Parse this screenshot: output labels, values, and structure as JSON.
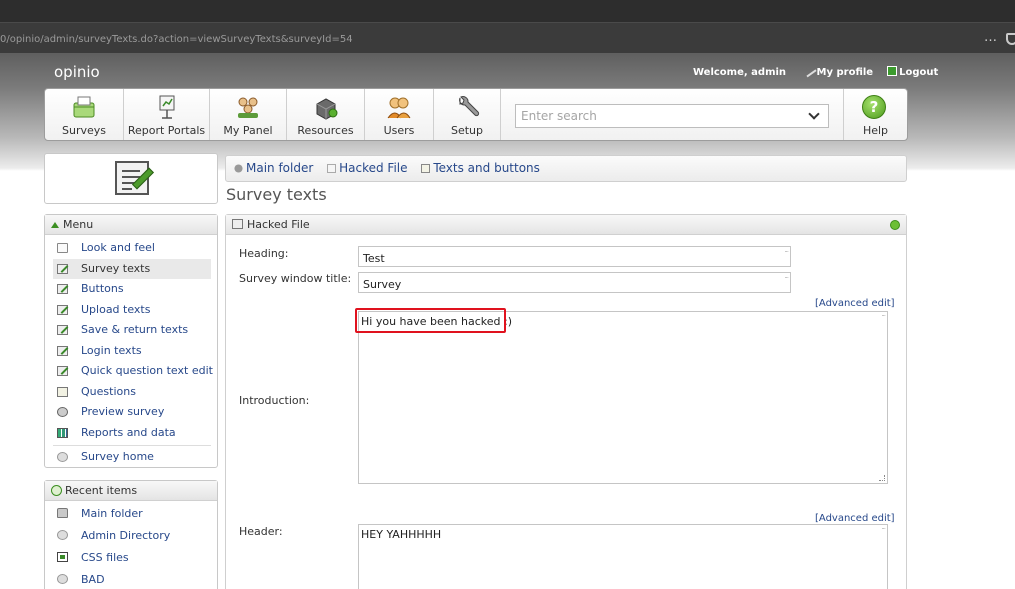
{
  "browser": {
    "url": "0/opinio/admin/surveyTexts.do?action=viewSurveyTexts&surveyId=54",
    "more_icon": "…"
  },
  "header": {
    "brand": "opinio",
    "welcome": "Welcome, admin",
    "my_profile": "My profile",
    "logout": "Logout"
  },
  "toolbar": {
    "items": [
      {
        "label": "Surveys",
        "icon": "surveys-icon"
      },
      {
        "label": "Report Portals",
        "icon": "report-portals-icon"
      },
      {
        "label": "My Panel",
        "icon": "my-panel-icon"
      },
      {
        "label": "Resources",
        "icon": "resources-icon"
      },
      {
        "label": "Users",
        "icon": "users-icon"
      },
      {
        "label": "Setup",
        "icon": "setup-icon"
      }
    ],
    "search_placeholder": "Enter search",
    "help_label": "Help",
    "help_glyph": "?"
  },
  "breadcrumb": {
    "items": [
      "Main folder",
      "Hacked File",
      "Texts and buttons"
    ]
  },
  "page_title": "Survey texts",
  "menu": {
    "title": "Menu",
    "items": [
      {
        "label": "Look and feel",
        "icon": "look-feel-icon"
      },
      {
        "label": "Survey texts",
        "icon": "edit-icon"
      },
      {
        "label": "Buttons",
        "icon": "edit-icon"
      },
      {
        "label": "Upload texts",
        "icon": "edit-icon"
      },
      {
        "label": "Save & return texts",
        "icon": "edit-icon"
      },
      {
        "label": "Login texts",
        "icon": "edit-icon"
      },
      {
        "label": "Quick question text edit",
        "icon": "edit-icon"
      },
      {
        "label": "Questions",
        "icon": "questions-icon"
      },
      {
        "label": "Preview survey",
        "icon": "eye-icon"
      },
      {
        "label": "Reports and data",
        "icon": "chart-icon"
      },
      {
        "label": "Survey home",
        "icon": "home-icon"
      }
    ]
  },
  "recent": {
    "title": "Recent items",
    "items": [
      {
        "label": "Main folder",
        "icon": "folder-icon"
      },
      {
        "label": "Admin Directory",
        "icon": "directory-icon"
      },
      {
        "label": "CSS files",
        "icon": "css-icon"
      },
      {
        "label": "BAD",
        "icon": "directory-icon"
      }
    ]
  },
  "form": {
    "panel_title": "Hacked File",
    "heading_label": "Heading:",
    "heading_value": "Test",
    "window_title_label": "Survey window title:",
    "window_title_value": "Survey",
    "advanced_edit": "[Advanced edit]",
    "introduction_label": "Introduction:",
    "introduction_value": "Hi you have been hacked :)",
    "header_label": "Header:",
    "header_value": "HEY YAHHHHH"
  },
  "colors": {
    "link": "#27488a",
    "highlight": "#e0121e",
    "accent_green": "#4c9b1b"
  }
}
